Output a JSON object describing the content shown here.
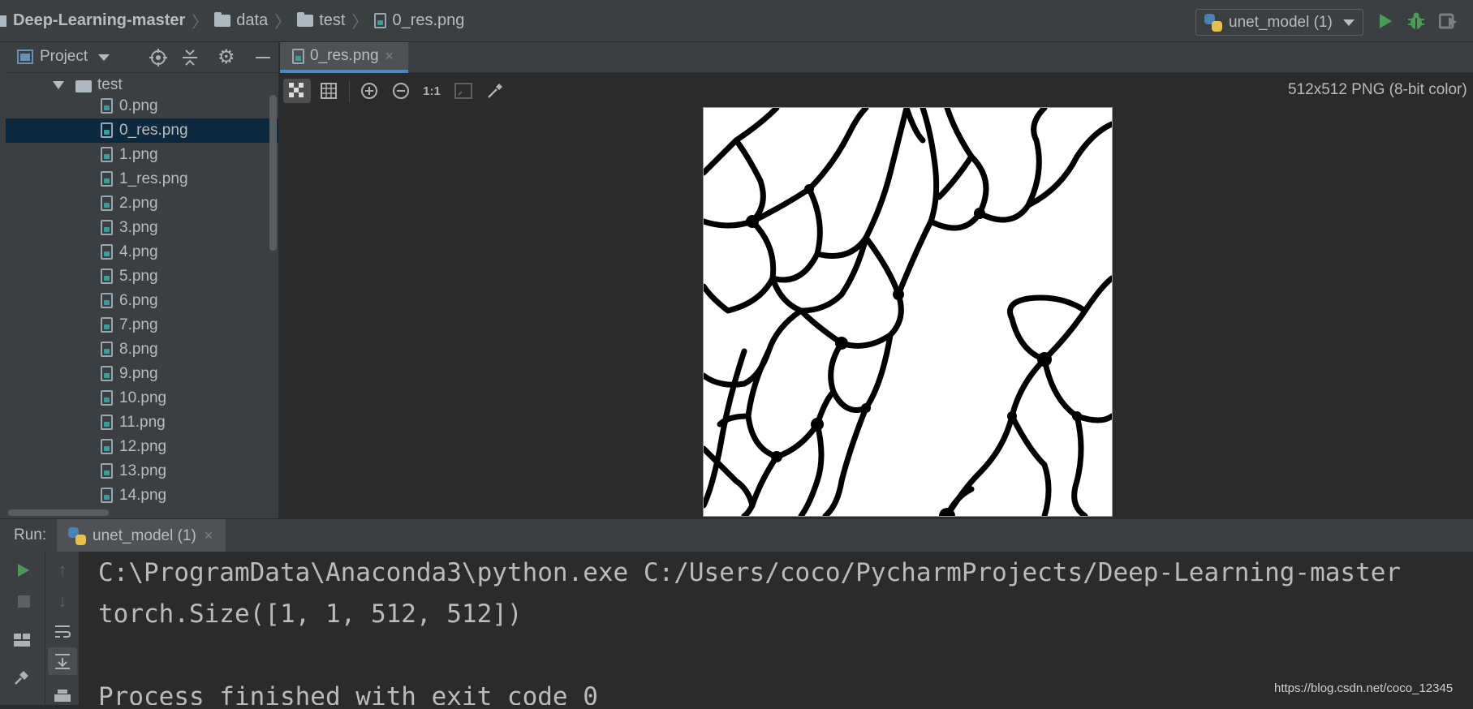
{
  "navbar": {
    "project_name": "Deep-Learning-master",
    "crumbs": [
      "data",
      "test",
      "0_res.png"
    ],
    "run_config": "unet_model (1)"
  },
  "project_panel": {
    "title": "Project",
    "folder": "test",
    "files": [
      "0.png",
      "0_res.png",
      "1.png",
      "1_res.png",
      "2.png",
      "3.png",
      "4.png",
      "5.png",
      "6.png",
      "7.png",
      "8.png",
      "9.png",
      "10.png",
      "11.png",
      "12.png",
      "13.png",
      "14.png"
    ],
    "selected_file": "0_res.png"
  },
  "editor": {
    "tab_label": "0_res.png",
    "close_glyph": "×",
    "zoom_actual_label": "1:1",
    "image_info": "512x512 PNG (8-bit color)"
  },
  "run": {
    "label": "Run:",
    "tab_label": "unet_model (1)",
    "close_glyph": "×",
    "console": [
      "C:\\ProgramData\\Anaconda3\\python.exe C:/Users/coco/PycharmProjects/Deep-Learning-master",
      "torch.Size([1, 1, 512, 512])",
      "",
      "Process finished with exit code 0"
    ]
  },
  "watermark": "https://blog.csdn.net/coco_12345",
  "colors": {
    "accent": "#4a88c7",
    "run_green": "#499c54",
    "selection": "#0d293e",
    "panel_bg": "#3c3f41",
    "editor_bg": "#2b2b2b"
  },
  "icons": [
    "project-icon",
    "locate-icon",
    "collapse-icon",
    "gear-icon",
    "minimize-icon",
    "chessboard-icon",
    "grid-icon",
    "zoom-in-icon",
    "zoom-out-icon",
    "fit-icon",
    "color-picker-icon",
    "python-icon",
    "run-icon",
    "debug-icon",
    "coverage-icon",
    "stop-icon",
    "wrap-icon",
    "scroll-end-icon",
    "pin-icon",
    "print-icon",
    "layout-icon",
    "up-arrow-icon",
    "down-arrow-icon"
  ]
}
